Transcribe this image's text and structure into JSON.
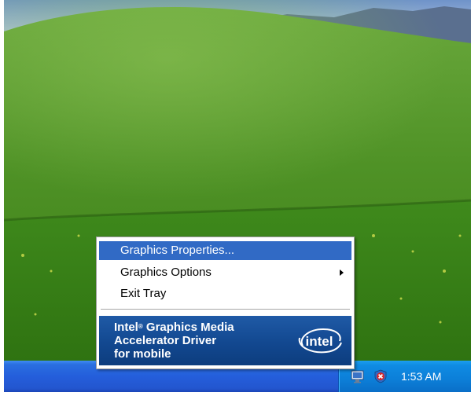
{
  "taskbar": {
    "clock": "1:53 AM",
    "tray_icons": [
      "intel-graphics-icon",
      "security-shield-icon"
    ],
    "colors": {
      "taskbar": "#245edb",
      "tray": "#0c7fd8"
    }
  },
  "context_menu": {
    "items": [
      {
        "label": "Graphics Properties...",
        "highlighted": true,
        "has_submenu": false
      },
      {
        "label": "Graphics Options",
        "highlighted": false,
        "has_submenu": true
      },
      {
        "label": "Exit Tray",
        "highlighted": false,
        "has_submenu": false
      }
    ],
    "highlight_color": "#316ac5",
    "banner": {
      "line1_prefix": "Intel",
      "line1_mark": "®",
      "line1_suffix": " Graphics Media",
      "line2": "Accelerator Driver",
      "line3": "for mobile",
      "logo_text": "intel",
      "color": "#124890"
    }
  },
  "desktop": {
    "wallpaper": "green-hills-blue-sky"
  }
}
